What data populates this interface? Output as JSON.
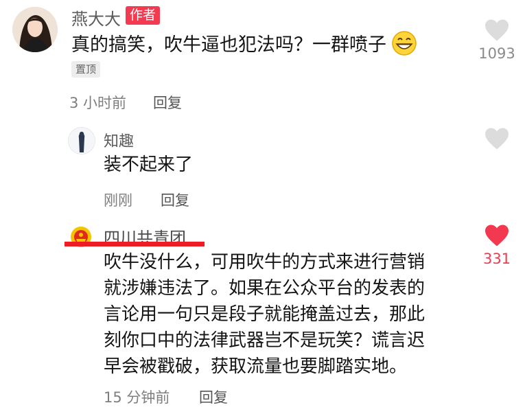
{
  "comments": [
    {
      "user": "燕大大",
      "author_badge": "作者",
      "text": "真的搞笑，吹牛逼也犯法吗？一群喷子",
      "emoji": "grin-emoji",
      "pin_label": "置顶",
      "time": "3 小时前",
      "reply_label": "回复",
      "likes": "1093",
      "liked": false
    },
    {
      "user": "知趣",
      "text": "装不起来了",
      "time": "刚刚",
      "reply_label": "回复",
      "liked": false
    },
    {
      "user": "四川共青团",
      "text_lines": [
        "吹牛没什么，可用吹牛的方式来进行营销",
        "就涉嫌违法了。如果在公众平台的发表的",
        "言论用一句只是段子就能掩盖过去，那此",
        "刻你口中的法律武器岂不是玩笑？谎言迟",
        "早会被戳破，获取流量也要脚踏实地。"
      ],
      "time": "15 分钟前",
      "reply_label": "回复",
      "likes": "331",
      "liked": true
    }
  ],
  "colors": {
    "accent_red": "#f23b51",
    "liked_heart": "#f2394f",
    "unliked_heart": "#dcdcdc",
    "annotation_red": "#ee1c25"
  }
}
